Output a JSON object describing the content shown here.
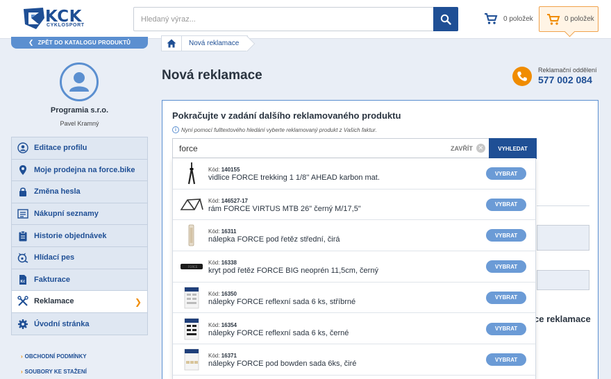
{
  "header": {
    "logo_text": "KCK",
    "logo_sub": "CYKLOSPORT",
    "search_placeholder": "Hledaný výraz...",
    "cart_count_1": "0 položek",
    "cart_count_2": "0 položek"
  },
  "sidebar": {
    "back_label": "ZPĚT DO KATALOGU PRODUKTŮ",
    "company": "Programia s.r.o.",
    "person": "Pavel Kramný",
    "items": [
      {
        "label": "Editace profilu",
        "icon": "user-icon"
      },
      {
        "label": "Moje prodejna na force.bike",
        "icon": "location-pin-icon"
      },
      {
        "label": "Změna hesla",
        "icon": "lock-icon"
      },
      {
        "label": "Nákupní seznamy",
        "icon": "list-icon"
      },
      {
        "label": "Historie objednávek",
        "icon": "clipboard-icon"
      },
      {
        "label": "Hlídací pes",
        "icon": "watchdog-icon"
      },
      {
        "label": "Fakturace",
        "icon": "invoice-icon"
      },
      {
        "label": "Reklamace",
        "icon": "tools-icon"
      },
      {
        "label": "Úvodní stránka",
        "icon": "gear-icon"
      }
    ],
    "footer_links": [
      "OBCHODNÍ PODMÍNKY",
      "SOUBORY KE STAŽENÍ"
    ]
  },
  "breadcrumb": {
    "current": "Nová reklamace"
  },
  "page": {
    "title": "Nová reklamace",
    "phone_label": "Reklamační oddělení",
    "phone_number": "577 002 084"
  },
  "panel": {
    "title": "Pokračujte v zadání dalšího reklamovaného produktu",
    "hint": "Nyní pomocí fulltextového hledání vyberte reklamovaný produkt z Vašich faktur.",
    "background_text": "ce reklamace",
    "search_value": "force",
    "close_label": "ZAVŘÍT",
    "search_button": "VYHLEDAT",
    "code_label": "Kód:",
    "pick_label": "VYBRAT",
    "results": [
      {
        "code": "140155",
        "name": "vidlice FORCE trekking 1 1/8'' AHEAD karbon mat.",
        "thumb": "fork-icon"
      },
      {
        "code": "146527-17",
        "name": "rám FORCE VIRTUS MTB 26\" černý M/17,5\"",
        "thumb": "frame-icon"
      },
      {
        "code": "16311",
        "name": "nálepka FORCE pod řetěz střední, čirá",
        "thumb": "sticker-strip-icon"
      },
      {
        "code": "16338",
        "name": "kryt pod řetěz FORCE BIG neoprén 11,5cm, černý",
        "thumb": "chainstay-cover-icon"
      },
      {
        "code": "16350",
        "name": "nálepky FORCE reflexní sada 6 ks, stříbrné",
        "thumb": "sticker-pack-icon"
      },
      {
        "code": "16354",
        "name": "nálepky FORCE reflexní sada 6 ks, černé",
        "thumb": "sticker-pack-icon"
      },
      {
        "code": "16371",
        "name": "nálepky FORCE pod bowden sada 6ks, čiré",
        "thumb": "sticker-pack-icon"
      }
    ]
  },
  "colors": {
    "brand_blue": "#1f4f95",
    "accent_orange": "#f08c00",
    "light_blue": "#5b8fd0"
  }
}
